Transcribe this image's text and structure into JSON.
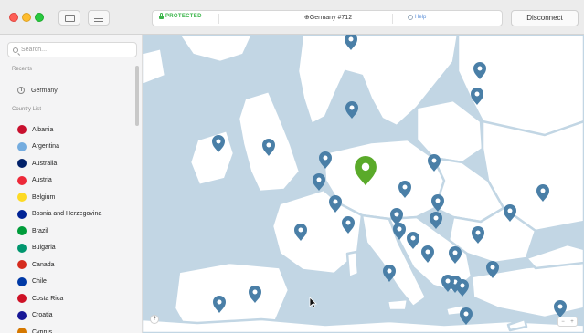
{
  "titlebar": {
    "status": "PROTECTED",
    "server": "Germany #712",
    "help": "Help",
    "disconnect": "Disconnect"
  },
  "sidebar": {
    "search_placeholder": "Search...",
    "recents_title": "Recents",
    "recents": [
      {
        "label": "Germany",
        "icon": "clock-icon"
      }
    ],
    "country_list_title": "Country List",
    "countries": [
      {
        "name": "Albania",
        "flag": "#c8102e"
      },
      {
        "name": "Argentina",
        "flag": "#74acdf"
      },
      {
        "name": "Australia",
        "flag": "#012169"
      },
      {
        "name": "Austria",
        "flag": "#ed2939"
      },
      {
        "name": "Belgium",
        "flag": "#fdda24"
      },
      {
        "name": "Bosnia and Herzegovina",
        "flag": "#002395"
      },
      {
        "name": "Brazil",
        "flag": "#009c3b"
      },
      {
        "name": "Bulgaria",
        "flag": "#00966e"
      },
      {
        "name": "Canada",
        "flag": "#d52b1e"
      },
      {
        "name": "Chile",
        "flag": "#0039a6"
      },
      {
        "name": "Costa Rica",
        "flag": "#ce1126"
      },
      {
        "name": "Croatia",
        "flag": "#171796"
      },
      {
        "name": "Cyprus",
        "flag": "#d57800"
      }
    ]
  },
  "map": {
    "help_button": "?",
    "zoom_out": "−",
    "zoom_in": "+",
    "colors": {
      "water": "#c2d6e4",
      "land": "#ffffff",
      "pin": "#4a7fa7",
      "active_pin": "#5aaa2a"
    }
  }
}
